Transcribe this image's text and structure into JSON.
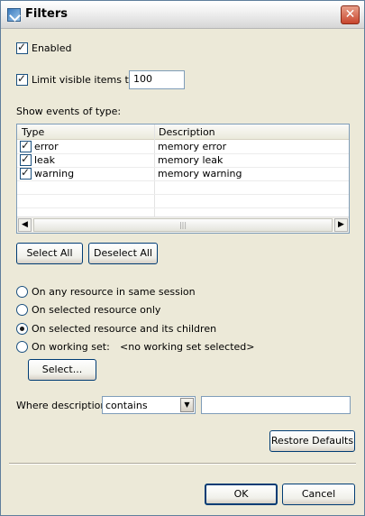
{
  "window": {
    "title": "Filters"
  },
  "enabled": {
    "label": "Enabled",
    "checked": true
  },
  "limit": {
    "label": "Limit visible items to:",
    "checked": true,
    "value": "100"
  },
  "events": {
    "heading": "Show events of type:",
    "columns": [
      "Type",
      "Description"
    ],
    "rows": [
      {
        "type": "error",
        "description": "memory error",
        "checked": true
      },
      {
        "type": "leak",
        "description": "memory leak",
        "checked": true
      },
      {
        "type": "warning",
        "description": "memory warning",
        "checked": true
      }
    ]
  },
  "buttons": {
    "select_all": "Select All",
    "deselect_all": "Deselect All",
    "select": "Select...",
    "restore_defaults": "Restore Defaults",
    "ok": "OK",
    "cancel": "Cancel"
  },
  "scope": {
    "options": [
      "On any resource in same session",
      "On selected resource only",
      "On selected resource and its children",
      "On working set:"
    ],
    "selected_index": 2,
    "working_set": "<no working set selected>"
  },
  "where": {
    "label": "Where description",
    "operator": "contains",
    "value": ""
  }
}
